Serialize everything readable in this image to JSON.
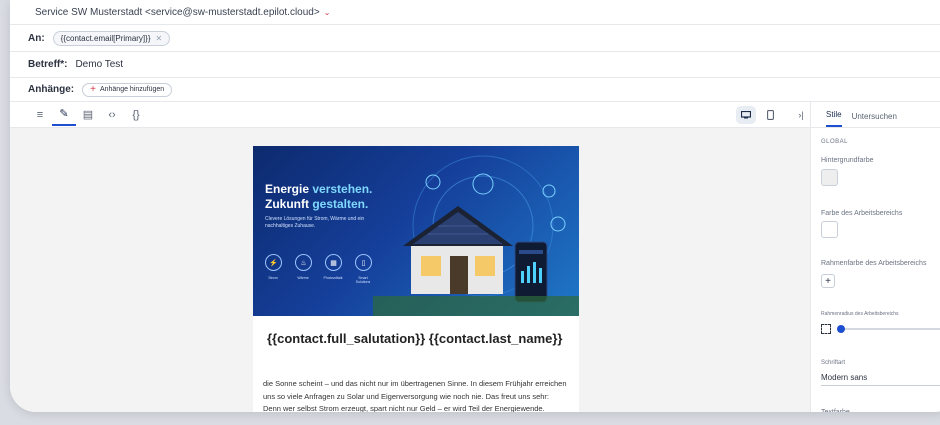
{
  "email": {
    "from": "Service SW Musterstadt <service@sw-musterstadt.epilot.cloud>",
    "to_label": "An:",
    "to_chip": "{{contact.email[Primary]}}",
    "subject_label": "Betreff*:",
    "subject_value": "Demo Test",
    "attach_label": "Anhänge:",
    "attach_button": "Anhänge hinzufügen"
  },
  "toolbar": {
    "icons": [
      "menu-icon",
      "pencil-icon",
      "layout-icon",
      "code-icon",
      "braces-icon"
    ],
    "device_icons": [
      "desktop-icon",
      "mobile-icon"
    ],
    "collapse_icon": "collapse-right-icon"
  },
  "panel": {
    "tab_styles": "Stile",
    "tab_inspect": "Untersuchen",
    "global": "GLOBAL",
    "bg_color": "Hintergrundfarbe",
    "work_color": "Farbe des Arbeitsbereichs",
    "frame_color": "Rahmenfarbe des Arbeitsbereichs",
    "frame_radius": "Rahmenradius des Arbeitsbereichs",
    "font_label": "Schriftart",
    "font_value": "Modern sans",
    "text_color": "Textfarbe"
  },
  "hero": {
    "line1_a": "Energie ",
    "line1_b": "verstehen.",
    "line2_a": "Zukunft ",
    "line2_b": "gestalten.",
    "subline": "Clevere Lösungen für Strom, Wärme und ein nachhaltiges Zuhause.",
    "icons": [
      {
        "label": "Strom",
        "glyph": "⚡"
      },
      {
        "label": "Wärme",
        "glyph": "♨"
      },
      {
        "label": "Photovoltaik",
        "glyph": "▦"
      },
      {
        "label": "Smart Solutions",
        "glyph": "▯"
      }
    ],
    "accent": "#7fd8ff"
  },
  "content": {
    "greeting": "{{contact.full_salutation}} {{contact.last_name}}",
    "paragraph": "die Sonne scheint – und das nicht nur im übertragenen Sinne. In diesem Frühjahr erreichen uns so viele Anfragen zu Solar und Eigenversorgung wie noch nie. Das freut uns sehr: Denn wer selbst Strom erzeugt, spart nicht nur Geld – er wird Teil der Energiewende."
  },
  "colors": {
    "accent_blue": "#1e4fd1",
    "accent_red": "#d33b4d"
  }
}
